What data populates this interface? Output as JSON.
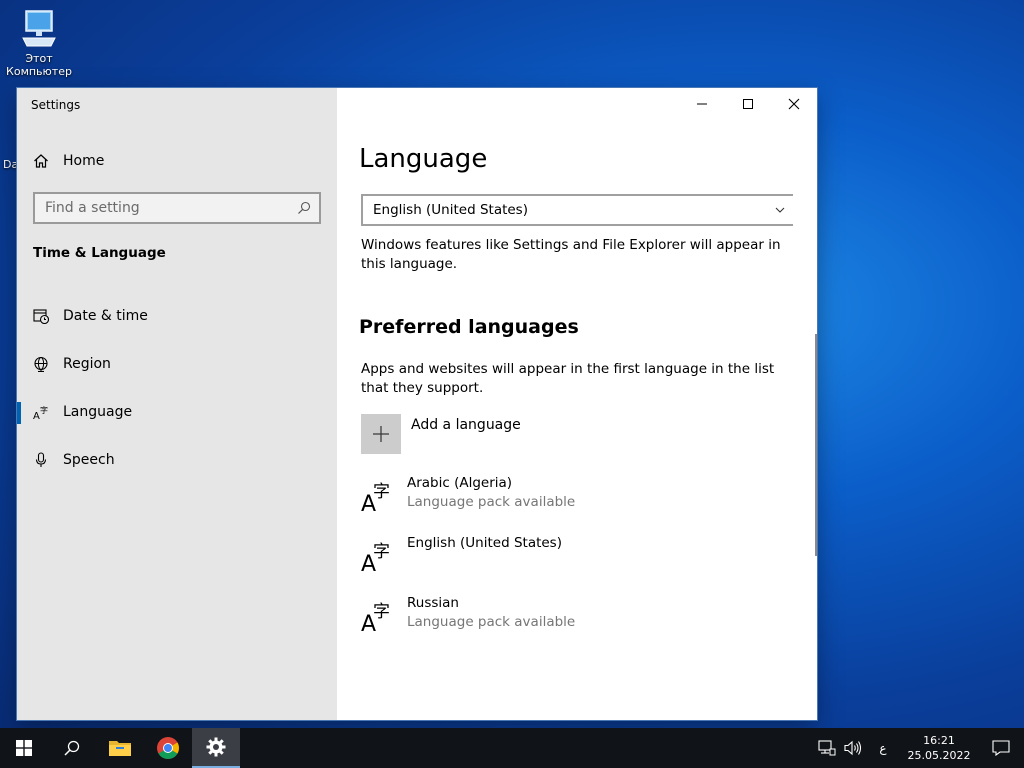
{
  "desktop": {
    "icon_label_line1": "Этот",
    "icon_label_line2": "Компьютер",
    "partial_label": "Da"
  },
  "window": {
    "title": "Settings",
    "controls": {
      "minimize": "minimize-icon",
      "maximize": "maximize-icon",
      "close": "close-icon"
    }
  },
  "sidebar": {
    "home_label": "Home",
    "search_placeholder": "Find a setting",
    "section_title": "Time & Language",
    "items": [
      {
        "label": "Date & time",
        "icon": "calendar-clock-icon"
      },
      {
        "label": "Region",
        "icon": "globe-icon"
      },
      {
        "label": "Language",
        "icon": "language-icon",
        "active": true
      },
      {
        "label": "Speech",
        "icon": "microphone-icon"
      }
    ]
  },
  "main": {
    "title": "Language",
    "display_language": {
      "selected": "English (United States)"
    },
    "display_language_desc": "Windows features like Settings and File Explorer will appear in this language.",
    "preferred_title": "Preferred languages",
    "preferred_desc": "Apps and websites will appear in the first language in the list that they support.",
    "add_language_label": "Add a language",
    "languages": [
      {
        "name": "Arabic (Algeria)",
        "status": "Language pack available"
      },
      {
        "name": "English (United States)",
        "status": ""
      },
      {
        "name": "Russian",
        "status": "Language pack available"
      }
    ]
  },
  "taskbar": {
    "input_language": "ع",
    "time": "16:21",
    "date": "25.05.2022"
  },
  "colors": {
    "accent": "#0063b1",
    "sidebar_bg": "#e6e6e6",
    "taskbar_bg": "#101317"
  }
}
